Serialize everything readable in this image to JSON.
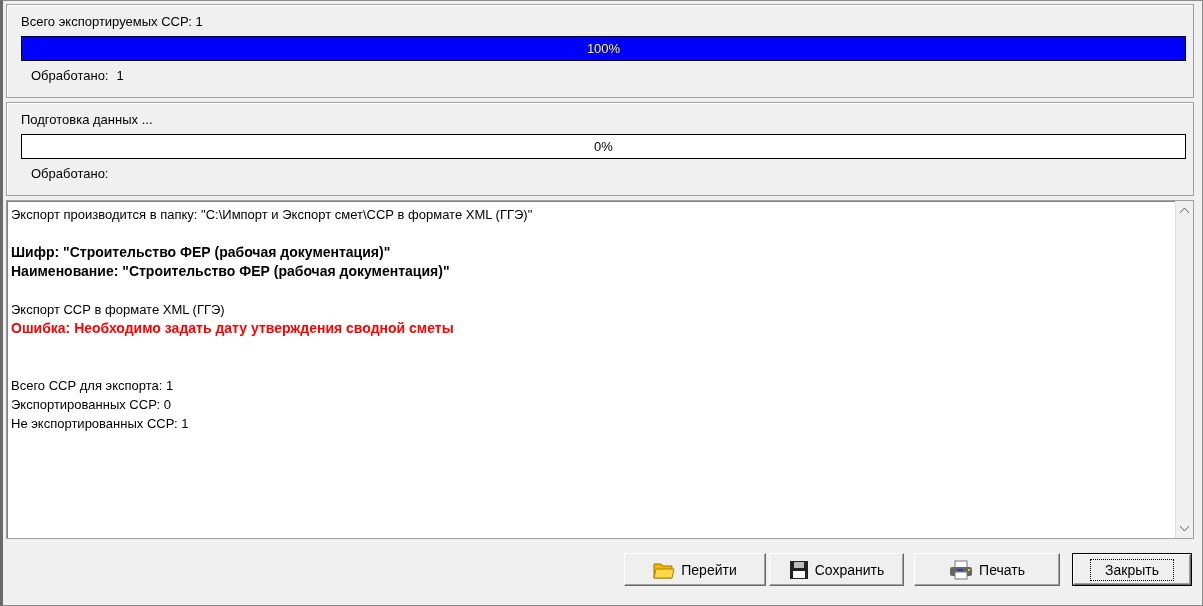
{
  "progress_panels": [
    {
      "title": "Всего экспортируемых ССР: 1",
      "level": 1,
      "reading": "100%",
      "processed_label": "Обработано:",
      "processed_value": "1"
    },
    {
      "title": "Подготовка данных ...",
      "level": 0,
      "reading": "0%",
      "processed_label": "Обработано:"
    }
  ],
  "log": [
    {
      "kind": "plain",
      "text": "Экспорт производится в папку: \"C:\\Импорт и Экспорт смет\\ССР в формате XML (ГГЭ)\""
    },
    {
      "kind": "blank"
    },
    {
      "kind": "bold",
      "text": "Шифр: \"Строительство ФЕР (рабочая документация)\""
    },
    {
      "kind": "bold",
      "text": "Наименование: \"Строительство ФЕР (рабочая документация)\""
    },
    {
      "kind": "blank"
    },
    {
      "kind": "plain",
      "text": "Экспорт ССР в формате XML (ГГЭ)"
    },
    {
      "kind": "error",
      "text": "Ошибка: Необходимо задать дату утверждения сводной сметы"
    },
    {
      "kind": "blank"
    },
    {
      "kind": "blank"
    },
    {
      "kind": "plain",
      "text": "Всего ССР для экспорта: 1"
    },
    {
      "kind": "plain",
      "text": "Экспортированных ССР: 0"
    },
    {
      "kind": "plain",
      "text": "Не экспортированных ССР: 1"
    }
  ],
  "buttons": [
    {
      "label": "Перейти",
      "kind": "folder",
      "default": false
    },
    {
      "label": "Сохранить",
      "kind": "save",
      "default": false
    },
    {
      "label": "Печать",
      "kind": "print",
      "default": false
    },
    {
      "label": "Закрыть",
      "kind": "plain",
      "default": true
    }
  ]
}
